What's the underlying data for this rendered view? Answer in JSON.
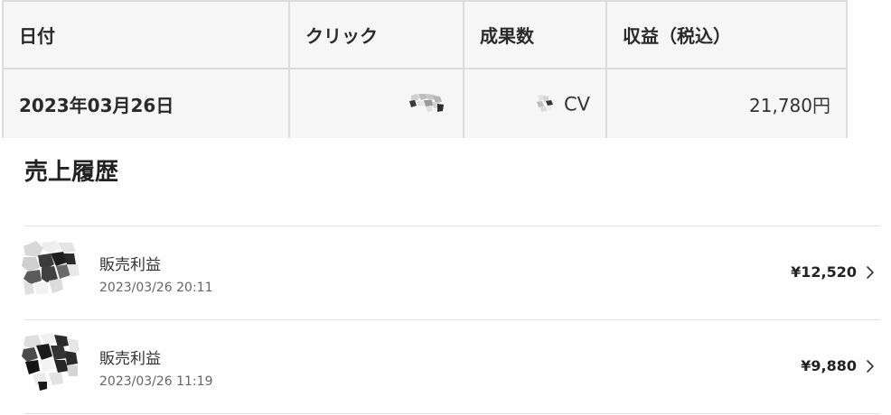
{
  "report": {
    "headers": {
      "date": "日付",
      "click": "クリック",
      "cv": "成果数",
      "revenue": "収益（税込）"
    },
    "row": {
      "date": "2023年03月26日",
      "cv_unit": "CV",
      "revenue": "21,780円"
    }
  },
  "sales_history": {
    "title": "売上履歴",
    "items": [
      {
        "label": "販売利益",
        "timestamp": "2023/03/26 20:11",
        "amount": "¥12,520"
      },
      {
        "label": "販売利益",
        "timestamp": "2023/03/26 11:19",
        "amount": "¥9,880"
      }
    ]
  }
}
